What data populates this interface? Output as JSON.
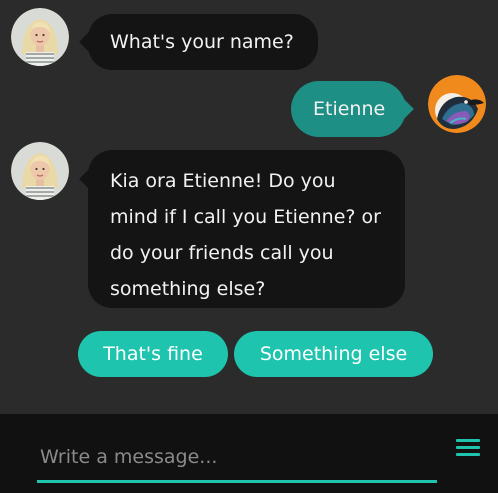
{
  "conversation": {
    "messages": [
      {
        "sender": "bot",
        "text": "What's your name?"
      },
      {
        "sender": "user",
        "text": "Etienne"
      },
      {
        "sender": "bot",
        "lines": [
          "Kia ora Etienne! Do you",
          "mind if I call you Etienne? or",
          "do your friends call you",
          "something else?"
        ]
      }
    ],
    "bot_avatar": "bot-avatar-icon",
    "user_avatar": "bird-avatar-icon"
  },
  "quick_replies": [
    "That's fine",
    "Something else"
  ],
  "composer": {
    "placeholder": "Write a message...",
    "value": "",
    "menu_icon": "hamburger-menu-icon"
  },
  "colors": {
    "background": "#2b2b2b",
    "bot_bubble": "#141414",
    "user_bubble": "#1e8f84",
    "accent": "#1fc4ae",
    "composer_bar": "#111111"
  }
}
